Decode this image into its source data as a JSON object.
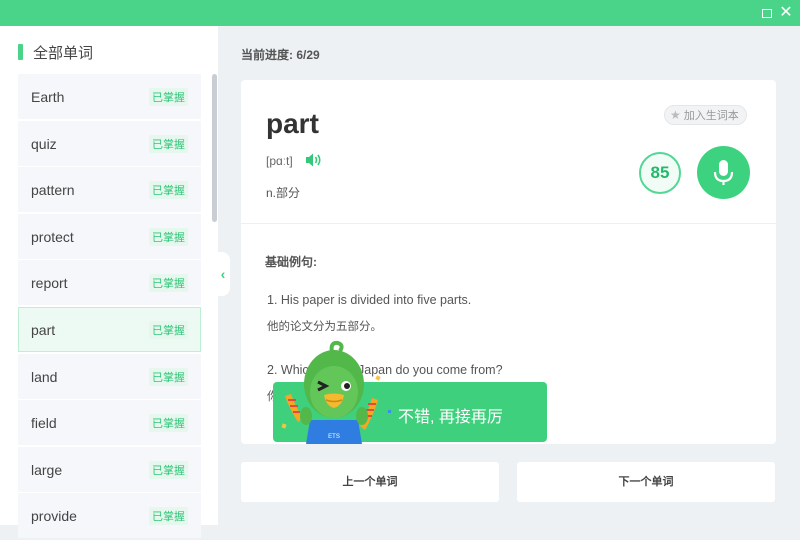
{
  "window": {
    "maximize_icon": "maximize-icon",
    "close_icon": "close-icon",
    "close_glyph": "✕"
  },
  "sidebar": {
    "title": "全部单词",
    "items": [
      {
        "word": "Earth",
        "status": "已掌握"
      },
      {
        "word": "quiz",
        "status": "已掌握"
      },
      {
        "word": "pattern",
        "status": "已掌握"
      },
      {
        "word": "protect",
        "status": "已掌握"
      },
      {
        "word": "report",
        "status": "已掌握"
      },
      {
        "word": "part",
        "status": "已掌握",
        "active": true
      },
      {
        "word": "land",
        "status": "已掌握"
      },
      {
        "word": "field",
        "status": "已掌握"
      },
      {
        "word": "large",
        "status": "已掌握"
      },
      {
        "word": "provide",
        "status": "已掌握"
      }
    ],
    "collapse_glyph": "‹"
  },
  "progress": {
    "text": "当前进度: 6/29"
  },
  "card": {
    "word": "part",
    "phonetic": "[pɑːt]",
    "meaning": "n.部分",
    "add_vocab_label": "加入生词本",
    "score": "85",
    "examples_label": "基础例句:",
    "examples": [
      {
        "en": "1. His paper is divided into five parts.",
        "zh": "他的论文分为五部分。"
      },
      {
        "en": "2. Which part of Japan do you come from?",
        "zh": "你"
      }
    ]
  },
  "toast": {
    "text": "不错, 再接再厉",
    "mascot_badge": "ETS"
  },
  "nav": {
    "prev": "上一个单词",
    "next": "下一个单词"
  },
  "colors": {
    "accent": "#4ad489",
    "mastered": "#33c57a"
  }
}
